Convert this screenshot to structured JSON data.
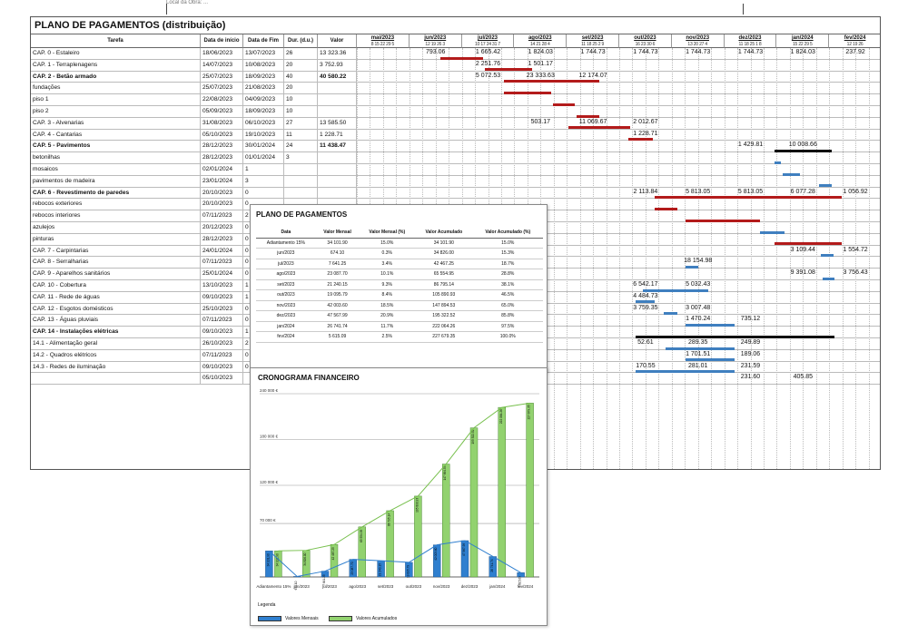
{
  "colors": {
    "red_bar": "#b31b1b",
    "blue_bar": "#3f7fbf",
    "black_bar": "#111111",
    "bar_monthly": "#2f7fcf",
    "bar_accum": "#92d26f",
    "line_monthly": "#2f7fcf",
    "line_accum": "#78c04e"
  },
  "top_strip": {
    "cut_text": "Local da Obra: ..."
  },
  "sheet": {
    "title": "PLANO DE PAGAMENTOS (distribuição)",
    "headers": {
      "task": "Tarefa",
      "start": "Data de início",
      "end": "Data de Fim",
      "dur": "Dur. (d.u.)",
      "value": "Valor"
    },
    "months": [
      {
        "name": "mai/2023",
        "days": "8  15  22  29  5"
      },
      {
        "name": "jun/2023",
        "days": "12  19  26  3"
      },
      {
        "name": "jul/2023",
        "days": "10  17  24  31  7"
      },
      {
        "name": "ago/2023",
        "days": "14  21  28  4"
      },
      {
        "name": "set/2023",
        "days": "11  18  25  2  9"
      },
      {
        "name": "out/2023",
        "days": "16  23  30  6"
      },
      {
        "name": "nov/2023",
        "days": "13  20  27  4"
      },
      {
        "name": "dez/2023",
        "days": "11  18  25  1  8"
      },
      {
        "name": "jan/2024",
        "days": "15  22  29  5"
      },
      {
        "name": "fev/2024",
        "days": "12  19  26"
      }
    ],
    "rows": [
      {
        "task": "CAP. 0 - Estaleiro",
        "start": "18/06/2023",
        "end": "13/07/2023",
        "dur": "26",
        "value": "13 323.36",
        "bold": false
      },
      {
        "task": "CAP. 1 - Terraplenagens",
        "start": "14/07/2023",
        "end": "10/08/2023",
        "dur": "20",
        "value": "3 752.93",
        "bold": false
      },
      {
        "task": "CAP. 2 - Betão armado",
        "start": "25/07/2023",
        "end": "18/09/2023",
        "dur": "40",
        "value": "40 580.22",
        "bold": true
      },
      {
        "task": "fundações",
        "start": "25/07/2023",
        "end": "21/08/2023",
        "dur": "20",
        "value": "",
        "bold": false
      },
      {
        "task": "piso 1",
        "start": "22/08/2023",
        "end": "04/09/2023",
        "dur": "10",
        "value": "",
        "bold": false
      },
      {
        "task": "piso 2",
        "start": "05/09/2023",
        "end": "18/09/2023",
        "dur": "10",
        "value": "",
        "bold": false
      },
      {
        "task": "CAP. 3 - Alvenarias",
        "start": "31/08/2023",
        "end": "06/10/2023",
        "dur": "27",
        "value": "13 585.50",
        "bold": false
      },
      {
        "task": "CAP. 4 - Cantarias",
        "start": "05/10/2023",
        "end": "19/10/2023",
        "dur": "11",
        "value": "1 228.71",
        "bold": false
      },
      {
        "task": "CAP. 5 - Pavimentos",
        "start": "28/12/2023",
        "end": "30/01/2024",
        "dur": "24",
        "value": "11 438.47",
        "bold": true
      },
      {
        "task": "betonilhas",
        "start": "28/12/2023",
        "end": "01/01/2024",
        "dur": "3",
        "value": "",
        "bold": false
      },
      {
        "task": "mosaicos",
        "start": "02/01/2024",
        "end": "1",
        "dur": "",
        "value": "",
        "bold": false
      },
      {
        "task": "pavimentos de madeira",
        "start": "23/01/2024",
        "end": "3",
        "dur": "",
        "value": "",
        "bold": false
      },
      {
        "task": "CAP. 6 - Revestimento de paredes",
        "start": "20/10/2023",
        "end": "0",
        "dur": "",
        "value": "",
        "bold": true
      },
      {
        "task": "rebocos exteriores",
        "start": "20/10/2023",
        "end": "0",
        "dur": "",
        "value": "",
        "bold": false
      },
      {
        "task": "rebocos interiores",
        "start": "07/11/2023",
        "end": "2",
        "dur": "",
        "value": "",
        "bold": false
      },
      {
        "task": "azulejos",
        "start": "20/12/2023",
        "end": "0",
        "dur": "",
        "value": "",
        "bold": false
      },
      {
        "task": "pinturas",
        "start": "28/12/2023",
        "end": "0",
        "dur": "",
        "value": "",
        "bold": false
      },
      {
        "task": "CAP. 7 - Carpintarias",
        "start": "24/01/2024",
        "end": "0",
        "dur": "",
        "value": "",
        "bold": false
      },
      {
        "task": "CAP. 8 - Serralharias",
        "start": "07/11/2023",
        "end": "0",
        "dur": "",
        "value": "",
        "bold": false
      },
      {
        "task": "CAP. 9 - Aparelhos sanitários",
        "start": "25/01/2024",
        "end": "0",
        "dur": "",
        "value": "",
        "bold": false
      },
      {
        "task": "CAP. 10 - Cobertura",
        "start": "13/10/2023",
        "end": "1",
        "dur": "",
        "value": "",
        "bold": false
      },
      {
        "task": "CAP. 11 - Rede de águas",
        "start": "09/10/2023",
        "end": "1",
        "dur": "",
        "value": "",
        "bold": false
      },
      {
        "task": "CAP. 12 - Esgotos domésticos",
        "start": "25/10/2023",
        "end": "0",
        "dur": "",
        "value": "",
        "bold": false
      },
      {
        "task": "CAP. 13 - Águas pluviais",
        "start": "07/11/2023",
        "end": "0",
        "dur": "",
        "value": "",
        "bold": false
      },
      {
        "task": "CAP. 14 - Instalações elétricas",
        "start": "09/10/2023",
        "end": "1",
        "dur": "",
        "value": "",
        "bold": true
      },
      {
        "task": "14.1 - Alimentação geral",
        "start": "26/10/2023",
        "end": "2",
        "dur": "",
        "value": "",
        "bold": false
      },
      {
        "task": "14.2 - Quadros elétricos",
        "start": "07/11/2023",
        "end": "0",
        "dur": "",
        "value": "",
        "bold": false
      },
      {
        "task": "14.3 - Redes de iluminação",
        "start": "09/10/2023",
        "end": "0",
        "dur": "",
        "value": "",
        "bold": false
      },
      {
        "task": "",
        "start": "05/10/2023",
        "end": "",
        "dur": "",
        "value": "",
        "bold": false
      }
    ],
    "month_values": [
      {
        "row": 0,
        "month": 1,
        "text": "793.06"
      },
      {
        "row": 0,
        "month": 2,
        "text": "1 665.42"
      },
      {
        "row": 0,
        "month": 3,
        "text": "1 824.03"
      },
      {
        "row": 0,
        "month": 4,
        "text": "1 744.73"
      },
      {
        "row": 0,
        "month": 5,
        "text": "1 744.73"
      },
      {
        "row": 0,
        "month": 6,
        "text": "1 744.73"
      },
      {
        "row": 0,
        "month": 7,
        "text": "1 744.73"
      },
      {
        "row": 0,
        "month": 8,
        "text": "1 824.03"
      },
      {
        "row": 0,
        "month": 9,
        "text": "237.92"
      },
      {
        "row": 1,
        "month": 2,
        "text": "2 251.76"
      },
      {
        "row": 1,
        "month": 3,
        "text": "1 501.17"
      },
      {
        "row": 2,
        "month": 2,
        "text": "5 072.53"
      },
      {
        "row": 2,
        "month": 3,
        "text": "23 333.63"
      },
      {
        "row": 2,
        "month": 4,
        "text": "12 174.07"
      },
      {
        "row": 6,
        "month": 3,
        "text": "503.17"
      },
      {
        "row": 6,
        "month": 4,
        "text": "11 069.67"
      },
      {
        "row": 6,
        "month": 5,
        "text": "2 012.67"
      },
      {
        "row": 7,
        "month": 5,
        "text": "1 228.71"
      },
      {
        "row": 8,
        "month": 7,
        "text": "1 429.81"
      },
      {
        "row": 8,
        "month": 8,
        "text": "10 008.66"
      },
      {
        "row": 12,
        "month": 5,
        "text": "2 113.84"
      },
      {
        "row": 12,
        "month": 6,
        "text": "5 813.05"
      },
      {
        "row": 12,
        "month": 7,
        "text": "5 813.05"
      },
      {
        "row": 12,
        "month": 8,
        "text": "6 077.28"
      },
      {
        "row": 12,
        "month": 9,
        "text": "1 056.92"
      },
      {
        "row": 17,
        "month": 8,
        "text": "3 109.44"
      },
      {
        "row": 17,
        "month": 9,
        "text": "1 554.72"
      },
      {
        "row": 18,
        "month": 6,
        "text": "18 154.98"
      },
      {
        "row": 19,
        "month": 8,
        "text": "9 391.08"
      },
      {
        "row": 19,
        "month": 9,
        "text": "3 756.43"
      },
      {
        "row": 20,
        "month": 5,
        "text": "6 542.17"
      },
      {
        "row": 20,
        "month": 6,
        "text": "5 032.43"
      },
      {
        "row": 21,
        "month": 5,
        "text": "4 484.73"
      },
      {
        "row": 22,
        "month": 5,
        "text": "3 759.35"
      },
      {
        "row": 22,
        "month": 6,
        "text": "3 007.48"
      },
      {
        "row": 23,
        "month": 6,
        "text": "1 470.24"
      },
      {
        "row": 23,
        "month": 7,
        "text": "735.12"
      },
      {
        "row": 25,
        "month": 5,
        "text": "52.61"
      },
      {
        "row": 25,
        "month": 6,
        "text": "289.35"
      },
      {
        "row": 25,
        "month": 7,
        "text": "249.89"
      },
      {
        "row": 26,
        "month": 6,
        "text": "1 701.51"
      },
      {
        "row": 26,
        "month": 7,
        "text": "189.06"
      },
      {
        "row": 27,
        "month": 5,
        "text": "170.55"
      },
      {
        "row": 27,
        "month": 6,
        "text": "281.01"
      },
      {
        "row": 27,
        "month": 7,
        "text": "231.59"
      },
      {
        "row": 28,
        "month": 7,
        "text": "231.60"
      },
      {
        "row": 28,
        "month": 8,
        "text": "405.85"
      }
    ]
  },
  "payment_table": {
    "title": "PLANO DE PAGAMENTOS",
    "columns": [
      "Data",
      "Valor Mensal",
      "Valor Mensal (%)",
      "Valor Acumulado",
      "Valor Acumulado (%)"
    ],
    "rows": [
      [
        "Adiantamento 15%",
        "34 101.90",
        "15.0%",
        "34 101.90",
        "15.0%"
      ],
      [
        "jun/2023",
        "674.10",
        "0.3%",
        "34 826.00",
        "15.3%"
      ],
      [
        "jul/2023",
        "7 641.25",
        "3.4%",
        "42 467.25",
        "18.7%"
      ],
      [
        "ago/2023",
        "23 087.70",
        "10.1%",
        "65 554.95",
        "28.8%"
      ],
      [
        "set/2023",
        "21 240.15",
        "9.3%",
        "86 795.14",
        "38.1%"
      ],
      [
        "out/2023",
        "19 095.79",
        "8.4%",
        "105 890.93",
        "46.5%"
      ],
      [
        "nov/2023",
        "42 003.60",
        "18.5%",
        "147 894.53",
        "65.0%"
      ],
      [
        "dez/2023",
        "47 567.99",
        "20.9%",
        "195 322.52",
        "85.8%"
      ],
      [
        "jan/2024",
        "26 741.74",
        "11.7%",
        "222 064.26",
        "97.5%"
      ],
      [
        "fev/2024",
        "5 615.09",
        "2.5%",
        "227 679.35",
        "100.0%"
      ]
    ]
  },
  "chart_data": {
    "type": "bar",
    "title": "CRONOGRAMA FINANCEIRO",
    "categories": [
      "Adiantamento 15%",
      "jun/2023",
      "jul/2023",
      "ago/2023",
      "set/2023",
      "out/2023",
      "nov/2023",
      "dez/2023",
      "jan/2024",
      "fev/2024"
    ],
    "y_tick_labels": [
      "240 000 €",
      "180 000 €",
      "120 000 €",
      "70 000 €"
    ],
    "y_ticks": [
      240000,
      180000,
      120000,
      70000
    ],
    "ylim": [
      0,
      240000
    ],
    "legend_title": "Legenda",
    "series": [
      {
        "name": "Valores Mensais",
        "values": [
          34101.9,
          674.1,
          7641.25,
          23087.7,
          21240.15,
          19095.79,
          42003.6,
          47567.99,
          26741.74,
          5615.09
        ]
      },
      {
        "name": "Valores Acumulados",
        "values": [
          34101.9,
          34826.0,
          42467.25,
          65554.95,
          86795.14,
          105890.93,
          147894.53,
          195322.52,
          222064.26,
          227679.35
        ]
      }
    ],
    "bar_labels_monthly": [
      "34 101.90",
      "674.10",
      "7 641.25",
      "23 087.70",
      "21 240.15",
      "19 095.79",
      "42 003.60",
      "47 567.99",
      "26 741.74",
      "5 615.09"
    ],
    "bar_labels_accum": [
      "34 101.90",
      "34 826.00",
      "42 467.25",
      "65 554.95",
      "86 795.14",
      "105 890.93",
      "147 894.53",
      "195 322.52",
      "222 064.26",
      "227 679.35"
    ]
  }
}
